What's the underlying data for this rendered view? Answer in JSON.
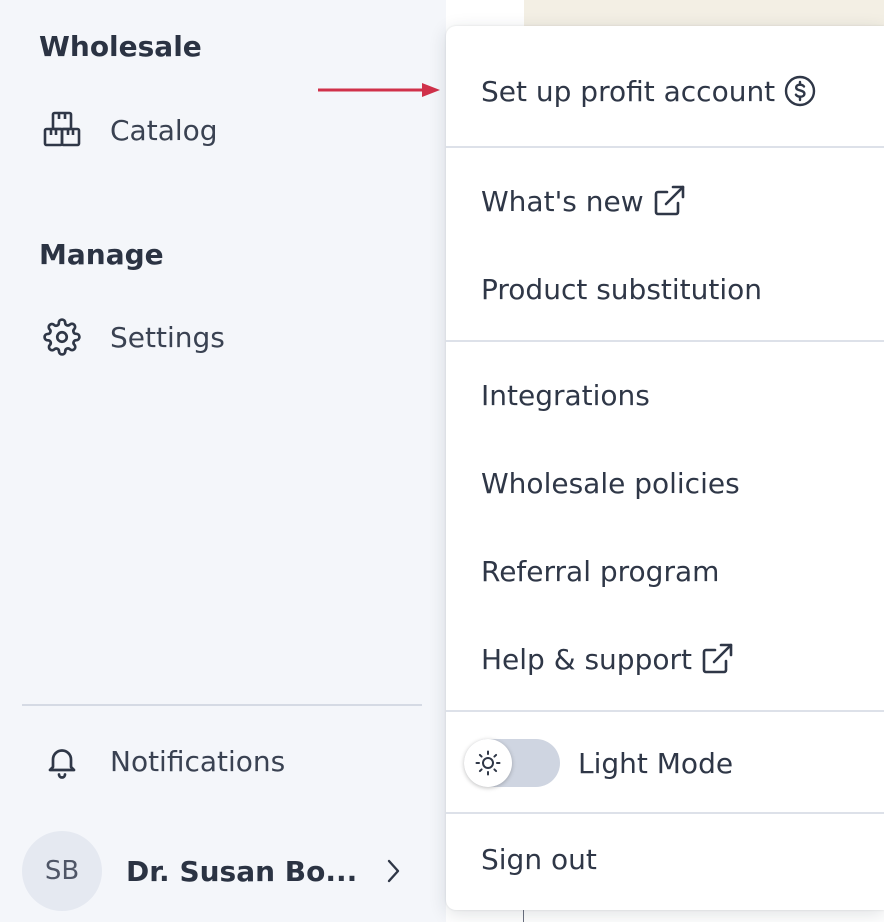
{
  "sidebar": {
    "sections": [
      {
        "title": "Wholesale",
        "items": [
          {
            "label": "Catalog",
            "icon": "boxes-icon"
          }
        ]
      },
      {
        "title": "Manage",
        "items": [
          {
            "label": "Settings",
            "icon": "gear-icon"
          }
        ]
      }
    ],
    "notifications_label": "Notifications",
    "user": {
      "initials": "SB",
      "name": "Dr. Susan Bo..."
    }
  },
  "menu": {
    "profit_account": "Set up profit account",
    "whats_new": "What's new",
    "product_substitution": "Product substitution",
    "integrations": "Integrations",
    "wholesale_policies": "Wholesale policies",
    "referral_program": "Referral program",
    "help_support": "Help & support",
    "theme_toggle_label": "Light Mode",
    "sign_out": "Sign out"
  },
  "colors": {
    "accent_arrow": "#d0314a",
    "sidebar_bg": "#f4f6fa",
    "text": "#2f3747"
  }
}
